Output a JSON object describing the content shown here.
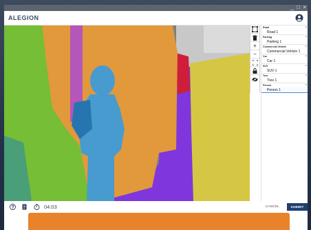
{
  "app": {
    "logo_text": "ALEGION",
    "window_controls": {
      "minimize": "_",
      "maximize": "□",
      "close": "×"
    }
  },
  "annotations": {
    "colors": {
      "road": "#8a3cf0",
      "parking": "#e8d84a",
      "commercial_vehicle": "#f5a640",
      "car": "#e0213f",
      "suv": "#3aa6d8",
      "tree": "#7fcf3a",
      "person": "#4fa9e0",
      "pole": "#c45fc8"
    }
  },
  "toolbar": {
    "tools": [
      {
        "name": "select-region-icon"
      },
      {
        "name": "delete-icon"
      },
      {
        "name": "zoom-in-icon",
        "glyph": "+"
      },
      {
        "name": "zoom-out-icon",
        "glyph": "−"
      },
      {
        "name": "fit-screen-icon"
      },
      {
        "name": "lock-icon"
      },
      {
        "name": "hide-icon"
      }
    ]
  },
  "side_panel": {
    "groups": [
      {
        "label": "Road",
        "items": [
          "Road 1"
        ]
      },
      {
        "label": "Parking",
        "items": [
          "Parking 1"
        ]
      },
      {
        "label": "Commercial Vehicle",
        "items": [
          "Commercial Vehicle 1"
        ]
      },
      {
        "label": "Car",
        "items": [
          "Car 1"
        ]
      },
      {
        "label": "SUV",
        "items": [
          "SUV 1"
        ]
      },
      {
        "label": "Tree",
        "items": [
          "Tree 1"
        ]
      },
      {
        "label": "Person",
        "items": [
          "Person 1"
        ]
      }
    ]
  },
  "footer": {
    "timer": "04:03",
    "cancel_label": "CANCEL",
    "submit_label": "SUBMIT"
  }
}
